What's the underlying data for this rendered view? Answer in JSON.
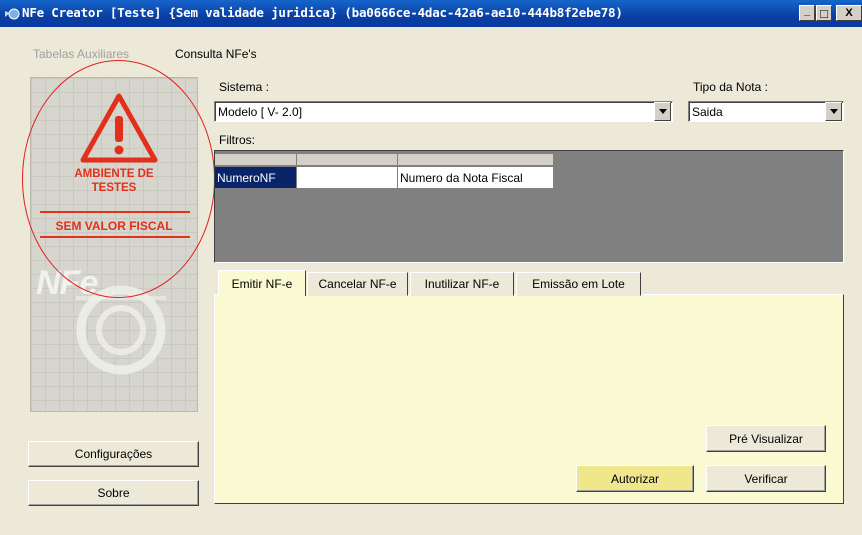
{
  "window": {
    "title": "NFe Creator [Teste] {Sem validade juridica} (ba0666ce-4dac-42a6-ae10-444b8f2ebe78)",
    "minimize": "_",
    "restore": "□",
    "close": "X"
  },
  "menu": {
    "items": [
      {
        "label": "Tabelas Auxiliares",
        "enabled": false
      },
      {
        "label": "Consulta NFe's",
        "enabled": true
      }
    ]
  },
  "banner": {
    "line1": "AMBIENTE DE",
    "line2": "TESTES",
    "line3": "SEM VALOR FISCAL",
    "logo": "NFe",
    "accent_color": "#e2301b"
  },
  "buttons": {
    "configuracoes": "Configurações",
    "sobre": "Sobre",
    "pre_visualizar": "Pré Visualizar",
    "autorizar": "Autorizar",
    "verificar": "Verificar"
  },
  "form": {
    "sistema_label": "Sistema :",
    "sistema_value": "Modelo [ V- 2.0]",
    "tipo_label": "Tipo da Nota :",
    "tipo_value": "Saida",
    "filtros_label": "Filtros:"
  },
  "filters_grid": {
    "row": {
      "name": "NumeroNF",
      "value": "",
      "description": "Numero da Nota Fiscal"
    }
  },
  "tabs": [
    {
      "label": "Emitir NF-e",
      "active": true
    },
    {
      "label": "Cancelar NF-e",
      "active": false
    },
    {
      "label": "Inutilizar NF-e",
      "active": false
    },
    {
      "label": "Emissão em Lote",
      "active": false
    }
  ]
}
